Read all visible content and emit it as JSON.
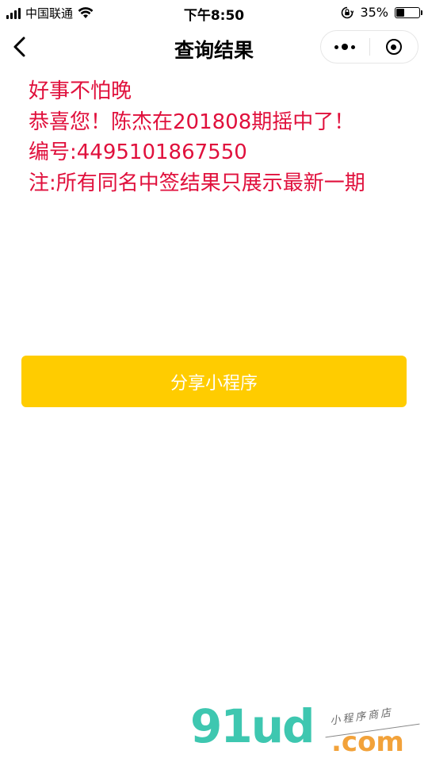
{
  "status_bar": {
    "carrier": "中国联通",
    "time": "下午8:50",
    "battery_percent_text": "35%",
    "battery_level": 0.35
  },
  "nav": {
    "title": "查询结果"
  },
  "result": {
    "line1": "好事不怕晚",
    "line2": "恭喜您！陈杰在201808期摇中了！",
    "line3": "编号:4495101867550",
    "line4": "注:所有同名中签结果只展示最新一期",
    "text_color": "#e0103c"
  },
  "share_button": {
    "label": "分享小程序",
    "color": "#ffcc00"
  },
  "watermark": {
    "logo": "91ud",
    "suffix": ".com",
    "tagline": "小程序商店"
  }
}
